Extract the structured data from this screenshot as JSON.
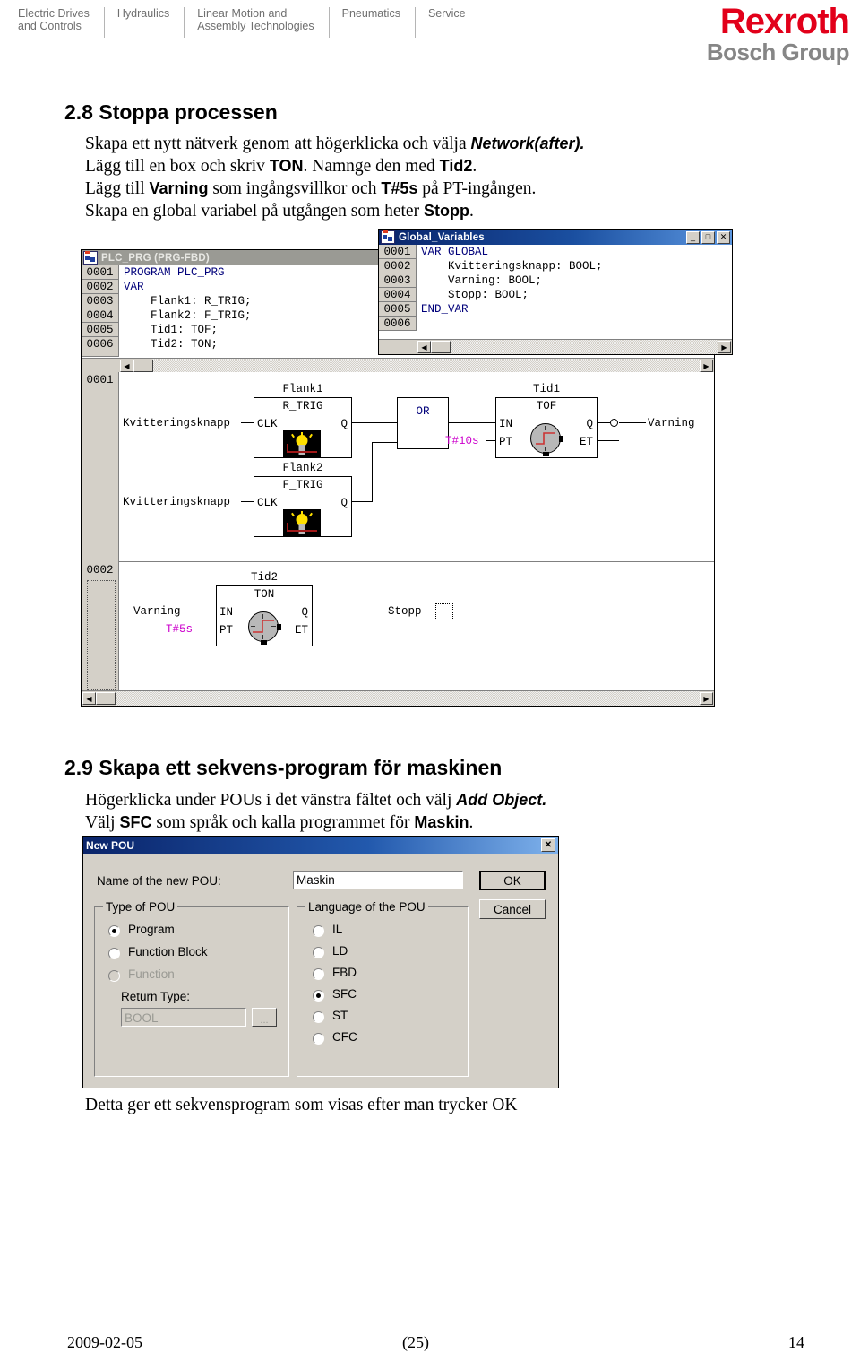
{
  "header": {
    "nav": [
      {
        "label": "Electric Drives\nand Controls"
      },
      {
        "label": "Hydraulics"
      },
      {
        "label": "Linear Motion and\nAssembly Technologies"
      },
      {
        "label": "Pneumatics"
      },
      {
        "label": "Service"
      }
    ],
    "logo_top": "Rexroth",
    "logo_bottom": "Bosch Group",
    "logo_color": "#e2001a",
    "logo_sub_color": "#868686"
  },
  "section28": {
    "heading": "2.8 Stoppa processen",
    "line1_a": "Skapa ett nytt nätverk genom att högerklicka och välja ",
    "line1_em": "Network(after).",
    "line2_a": "Lägg till en box och skriv ",
    "line2_b1": "TON",
    "line2_c": ". Namnge den med ",
    "line2_b2": "Tid2",
    "line2_d": ".",
    "line3_a": "Lägg till ",
    "line3_b1": "Varning",
    "line3_c": " som ingångsvillkor och ",
    "line3_b2": "T#5s",
    "line3_d": " på PT-ingången.",
    "line4_a": "Skapa en global variabel på utgången som heter ",
    "line4_b": "Stopp",
    "line4_c": "."
  },
  "plc_window": {
    "title": "PLC_PRG (PRG-FBD)",
    "icon": "pou-icon",
    "lines": [
      {
        "num": "0001",
        "text": "PROGRAM PLC_PRG",
        "kw": true
      },
      {
        "num": "0002",
        "text": "VAR",
        "kw": true
      },
      {
        "num": "0003",
        "text": "    Flank1: R_TRIG;",
        "kw": false
      },
      {
        "num": "0004",
        "text": "    Flank2: F_TRIG;",
        "kw": false
      },
      {
        "num": "0005",
        "text": "    Tid1: TOF;",
        "kw": false
      },
      {
        "num": "0006",
        "text": "    Tid2: TON;",
        "kw": false
      }
    ],
    "scroll_left": "◀",
    "scroll_right": "▶"
  },
  "globals_window": {
    "title": "Global_Variables",
    "icon": "pou-icon",
    "minimize": "_",
    "maximize": "□",
    "close": "✕",
    "lines": [
      {
        "num": "0001",
        "text": "VAR_GLOBAL"
      },
      {
        "num": "0002",
        "text": "    Kvitteringsknapp: BOOL;"
      },
      {
        "num": "0003",
        "text": "    Varning: BOOL;"
      },
      {
        "num": "0004",
        "text": "    Stopp: BOOL;"
      },
      {
        "num": "0005",
        "text": "END_VAR"
      },
      {
        "num": "0006",
        "text": ""
      }
    ],
    "scroll_left": "◀",
    "scroll_right": "▶"
  },
  "fbd": {
    "network1": {
      "number": "0001",
      "blocks": [
        {
          "instance": "Flank1",
          "type": "R_TRIG",
          "inputs": [
            "CLK"
          ],
          "outputs": [
            "Q"
          ],
          "icon": "lamp-icon"
        },
        {
          "instance": "Flank2",
          "type": "F_TRIG",
          "inputs": [
            "CLK"
          ],
          "outputs": [
            "Q"
          ],
          "icon": "lamp-icon"
        },
        {
          "instance": "",
          "type": "OR",
          "inputs": [
            "",
            ""
          ],
          "outputs": [
            ""
          ],
          "icon": "none"
        },
        {
          "instance": "Tid1",
          "type": "TOF",
          "inputs": [
            "IN",
            "PT"
          ],
          "outputs": [
            "Q",
            "ET"
          ],
          "icon": "clock-icon"
        }
      ],
      "input_labels": [
        "Kvitteringsknapp",
        "Kvitteringsknapp"
      ],
      "pt_literal": "T#10s",
      "output_label": "Varning",
      "negated_output": true
    },
    "network2": {
      "number": "0002",
      "blocks": [
        {
          "instance": "Tid2",
          "type": "TON",
          "inputs": [
            "IN",
            "PT"
          ],
          "outputs": [
            "Q",
            "ET"
          ],
          "icon": "clock-icon"
        }
      ],
      "input_label": "Varning",
      "pt_literal": "T#5s",
      "output_label": "Stopp"
    },
    "scroll_left": "◀",
    "scroll_right": "▶"
  },
  "section29": {
    "heading": "2.9 Skapa ett sekvens-program för maskinen",
    "line1_a": "Högerklicka under POUs i det vänstra fältet och välj ",
    "line1_em": "Add Object.",
    "line2_a": "Välj ",
    "line2_b1": "SFC",
    "line2_c": " som språk och kalla programmet för ",
    "line2_b2": "Maskin",
    "line2_d": "."
  },
  "new_pou_dialog": {
    "title": "New POU",
    "close": "✕",
    "name_label": "Name of the new POU:",
    "name_value": "Maskin",
    "name_placeholder": "",
    "ok_label": "OK",
    "cancel_label": "Cancel",
    "type_group_label": "Type of POU",
    "type_options": [
      {
        "label": "Program",
        "selected": true,
        "disabled": false
      },
      {
        "label": "Function Block",
        "selected": false,
        "disabled": false
      },
      {
        "label": "Function",
        "selected": false,
        "disabled": true
      }
    ],
    "return_type_label": "Return Type:",
    "return_type_value": "BOOL",
    "return_type_disabled": true,
    "browse_label": "...",
    "language_group_label": "Language of the POU",
    "language_options": [
      {
        "label": "IL",
        "selected": false
      },
      {
        "label": "LD",
        "selected": false
      },
      {
        "label": "FBD",
        "selected": false
      },
      {
        "label": "SFC",
        "selected": true
      },
      {
        "label": "ST",
        "selected": false
      },
      {
        "label": "CFC",
        "selected": false
      }
    ]
  },
  "closing_note": "Detta ger ett sekvensprogram som visas efter man trycker OK",
  "footer": {
    "date": "2009-02-05",
    "center": "(25)",
    "page": "14"
  }
}
